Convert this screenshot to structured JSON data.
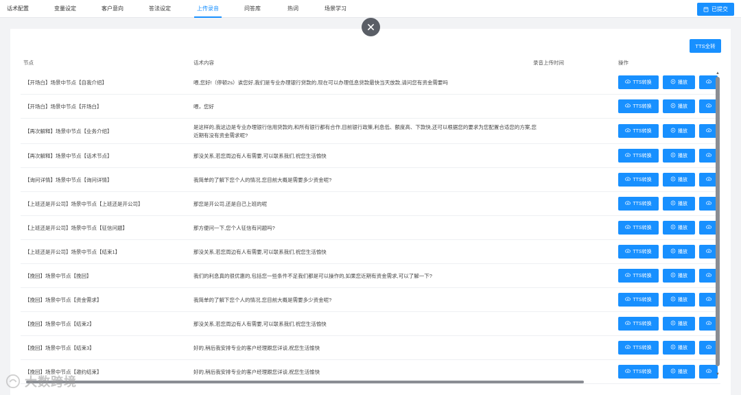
{
  "tabs": [
    {
      "label": "话术配置",
      "active": false
    },
    {
      "label": "变量设定",
      "active": false
    },
    {
      "label": "客户意向",
      "active": false
    },
    {
      "label": "答法设定",
      "active": false
    },
    {
      "label": "上传录音",
      "active": true
    },
    {
      "label": "问答库",
      "active": false
    },
    {
      "label": "热词",
      "active": false
    },
    {
      "label": "场景学习",
      "active": false
    }
  ],
  "submit_label": "已提交",
  "tts_all_label": "TTS全转",
  "columns": {
    "node": "节点",
    "content": "话术内容",
    "upload_time": "录音上传时间",
    "action": "操作"
  },
  "row_buttons": {
    "tts": "TTS转换",
    "play": "播放"
  },
  "rows": [
    {
      "node": "【开场白】场景中节点【自我介绍】",
      "content": "喂,您好!（停顿2s）诶您好,我们是专业办理银行贷款的,现在可以办理低息贷款最快当天放款,请问您有资金需要吗",
      "time": ""
    },
    {
      "node": "【开场白】场景中节点【开场白】",
      "content": "喂，您好",
      "time": ""
    },
    {
      "node": "【再次解释】场景中节点【业务介绍】",
      "content": "是这样的,我这边是专业办理银行信用贷款的,和所有银行都有合作,目前银行政策,利息低、额度高、下款快,还可以根据您的要求为您配置合适您的方案,您近期有没有资金需求呢?",
      "time": ""
    },
    {
      "node": "【再次解释】场景中节点【话术节点】",
      "content": "那没关系,若您周边有人有需要,可以联系我们,祝您生活愉快",
      "time": ""
    },
    {
      "node": "【询问详情】场景中节点【询问详情】",
      "content": "我简单的了解下您个人的情况,您目前大概是需要多少资金呢?",
      "time": ""
    },
    {
      "node": "【上班还是开公司】场景中节点【上班还是开公司】",
      "content": "那您是开公司,还是自己上班的呢",
      "time": ""
    },
    {
      "node": "【上班还是开公司】场景中节点【征信问题】",
      "content": "那方便问一下,您个人征信有问题吗?",
      "time": ""
    },
    {
      "node": "【上班还是开公司】场景中节点【结束1】",
      "content": "那没关系,若您周边有人有需要,可以联系我们,祝您生活愉快",
      "time": ""
    },
    {
      "node": "【挽回】场景中节点【挽回】",
      "content": "我们的利息真的很优惠的,包括您一些条件不足我们都是可以操作的,如果您近期有资金需求,可以了解一下?",
      "time": ""
    },
    {
      "node": "【挽回】场景中节点【资金需求】",
      "content": "我简单的了解下您个人的情况,您目前大概是需要多少资金呢?",
      "time": ""
    },
    {
      "node": "【挽回】场景中节点【结束2】",
      "content": "那没关系,若您周边有人有需要,可以联系我们,祝您生活愉快",
      "time": ""
    },
    {
      "node": "【挽回】场景中节点【结束3】",
      "content": "好的,稍后我安排专业的客户经理跟您详谈,祝您生活愉快",
      "time": ""
    },
    {
      "node": "【挽回】场景中节点【邀约结束】",
      "content": "好的,稍后我安排专业的客户经理跟您详谈,祝您生活愉快",
      "time": ""
    }
  ],
  "watermark": "大数跨境"
}
